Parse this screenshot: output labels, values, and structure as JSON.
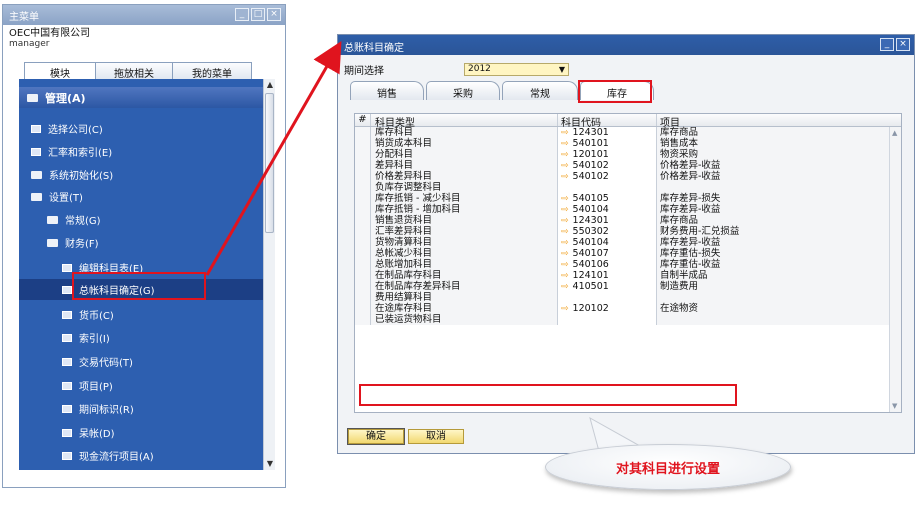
{
  "main_menu": {
    "title": "主菜单",
    "company": "OEC中国有限公司",
    "user": "manager",
    "tabs": [
      {
        "label": "模块",
        "active": true
      },
      {
        "label": "拖放相关",
        "active": false
      },
      {
        "label": "我的菜单",
        "active": false
      }
    ],
    "tree": [
      {
        "label": "管理(A)",
        "kind": "header"
      },
      {
        "label": "选择公司(C)",
        "kind": "doc"
      },
      {
        "label": "汇率和索引(E)",
        "kind": "doc"
      },
      {
        "label": "系统初始化(S)",
        "kind": "folder"
      },
      {
        "label": "设置(T)",
        "kind": "folder-open"
      },
      {
        "label": "常规(G)",
        "kind": "folder"
      },
      {
        "label": "财务(F)",
        "kind": "folder-open"
      },
      {
        "label": "编辑科目表(E)",
        "kind": "doc"
      },
      {
        "label": "总帐科目确定(G)",
        "kind": "doc",
        "selected": true
      },
      {
        "label": "货币(C)",
        "kind": "doc"
      },
      {
        "label": "索引(I)",
        "kind": "doc"
      },
      {
        "label": "交易代码(T)",
        "kind": "doc"
      },
      {
        "label": "项目(P)",
        "kind": "doc"
      },
      {
        "label": "期间标识(R)",
        "kind": "doc"
      },
      {
        "label": "呆帐(D)",
        "kind": "doc"
      },
      {
        "label": "现金流行项目(A)",
        "kind": "doc"
      }
    ]
  },
  "gl_window": {
    "title": "总账科目确定",
    "period_label": "期间选择",
    "period_value": "2012",
    "tabs": [
      {
        "label": "销售",
        "active": false
      },
      {
        "label": "采购",
        "active": false
      },
      {
        "label": "常规",
        "active": false
      },
      {
        "label": "库存",
        "active": true
      }
    ],
    "columns": {
      "num": "#",
      "type": "科目类型",
      "code": "科目代码",
      "item": "项目"
    },
    "rows": [
      {
        "type": "库存科目",
        "code": "124301",
        "item": "库存商品"
      },
      {
        "type": "销货成本科目",
        "code": "540101",
        "item": "销售成本"
      },
      {
        "type": "分配科目",
        "code": "120101",
        "item": "物资采购"
      },
      {
        "type": "差异科目",
        "code": "540102",
        "item": "价格差异-收益"
      },
      {
        "type": "价格差异科目",
        "code": "540102",
        "item": "价格差异-收益"
      },
      {
        "type": "负库存调整科目",
        "code": "",
        "item": ""
      },
      {
        "type": "库存抵销 - 减少科目",
        "code": "540105",
        "item": "库存差异-损失"
      },
      {
        "type": "库存抵销 - 增加科目",
        "code": "540104",
        "item": "库存差异-收益"
      },
      {
        "type": "销售退货科目",
        "code": "124301",
        "item": "库存商品"
      },
      {
        "type": "汇率差异科目",
        "code": "550302",
        "item": "财务费用-汇兑损益"
      },
      {
        "type": "货物清算科目",
        "code": "540104",
        "item": "库存差异-收益"
      },
      {
        "type": "总帐减少科目",
        "code": "540107",
        "item": "库存重估-损失"
      },
      {
        "type": "总账增加科目",
        "code": "540106",
        "item": "库存重估-收益"
      },
      {
        "type": "在制品库存科目",
        "code": "124101",
        "item": "自制半成品"
      },
      {
        "type": "在制品库存差异科目",
        "code": "410501",
        "item": "制造费用"
      },
      {
        "type": "费用结算科目",
        "code": "",
        "item": ""
      },
      {
        "type": "在途库存科目",
        "code": "120102",
        "item": "在途物资"
      },
      {
        "type": "已装运货物科目",
        "code": "",
        "item": ""
      }
    ],
    "ok_label": "确定",
    "cancel_label": "取消"
  },
  "callout": {
    "text": "对其科目进行设置"
  },
  "colors": {
    "highlight": "#e0141e",
    "tree_bg": "#2d5fb0",
    "title_bar": "#2e5ea8",
    "code_arrow": "#f0a020"
  }
}
